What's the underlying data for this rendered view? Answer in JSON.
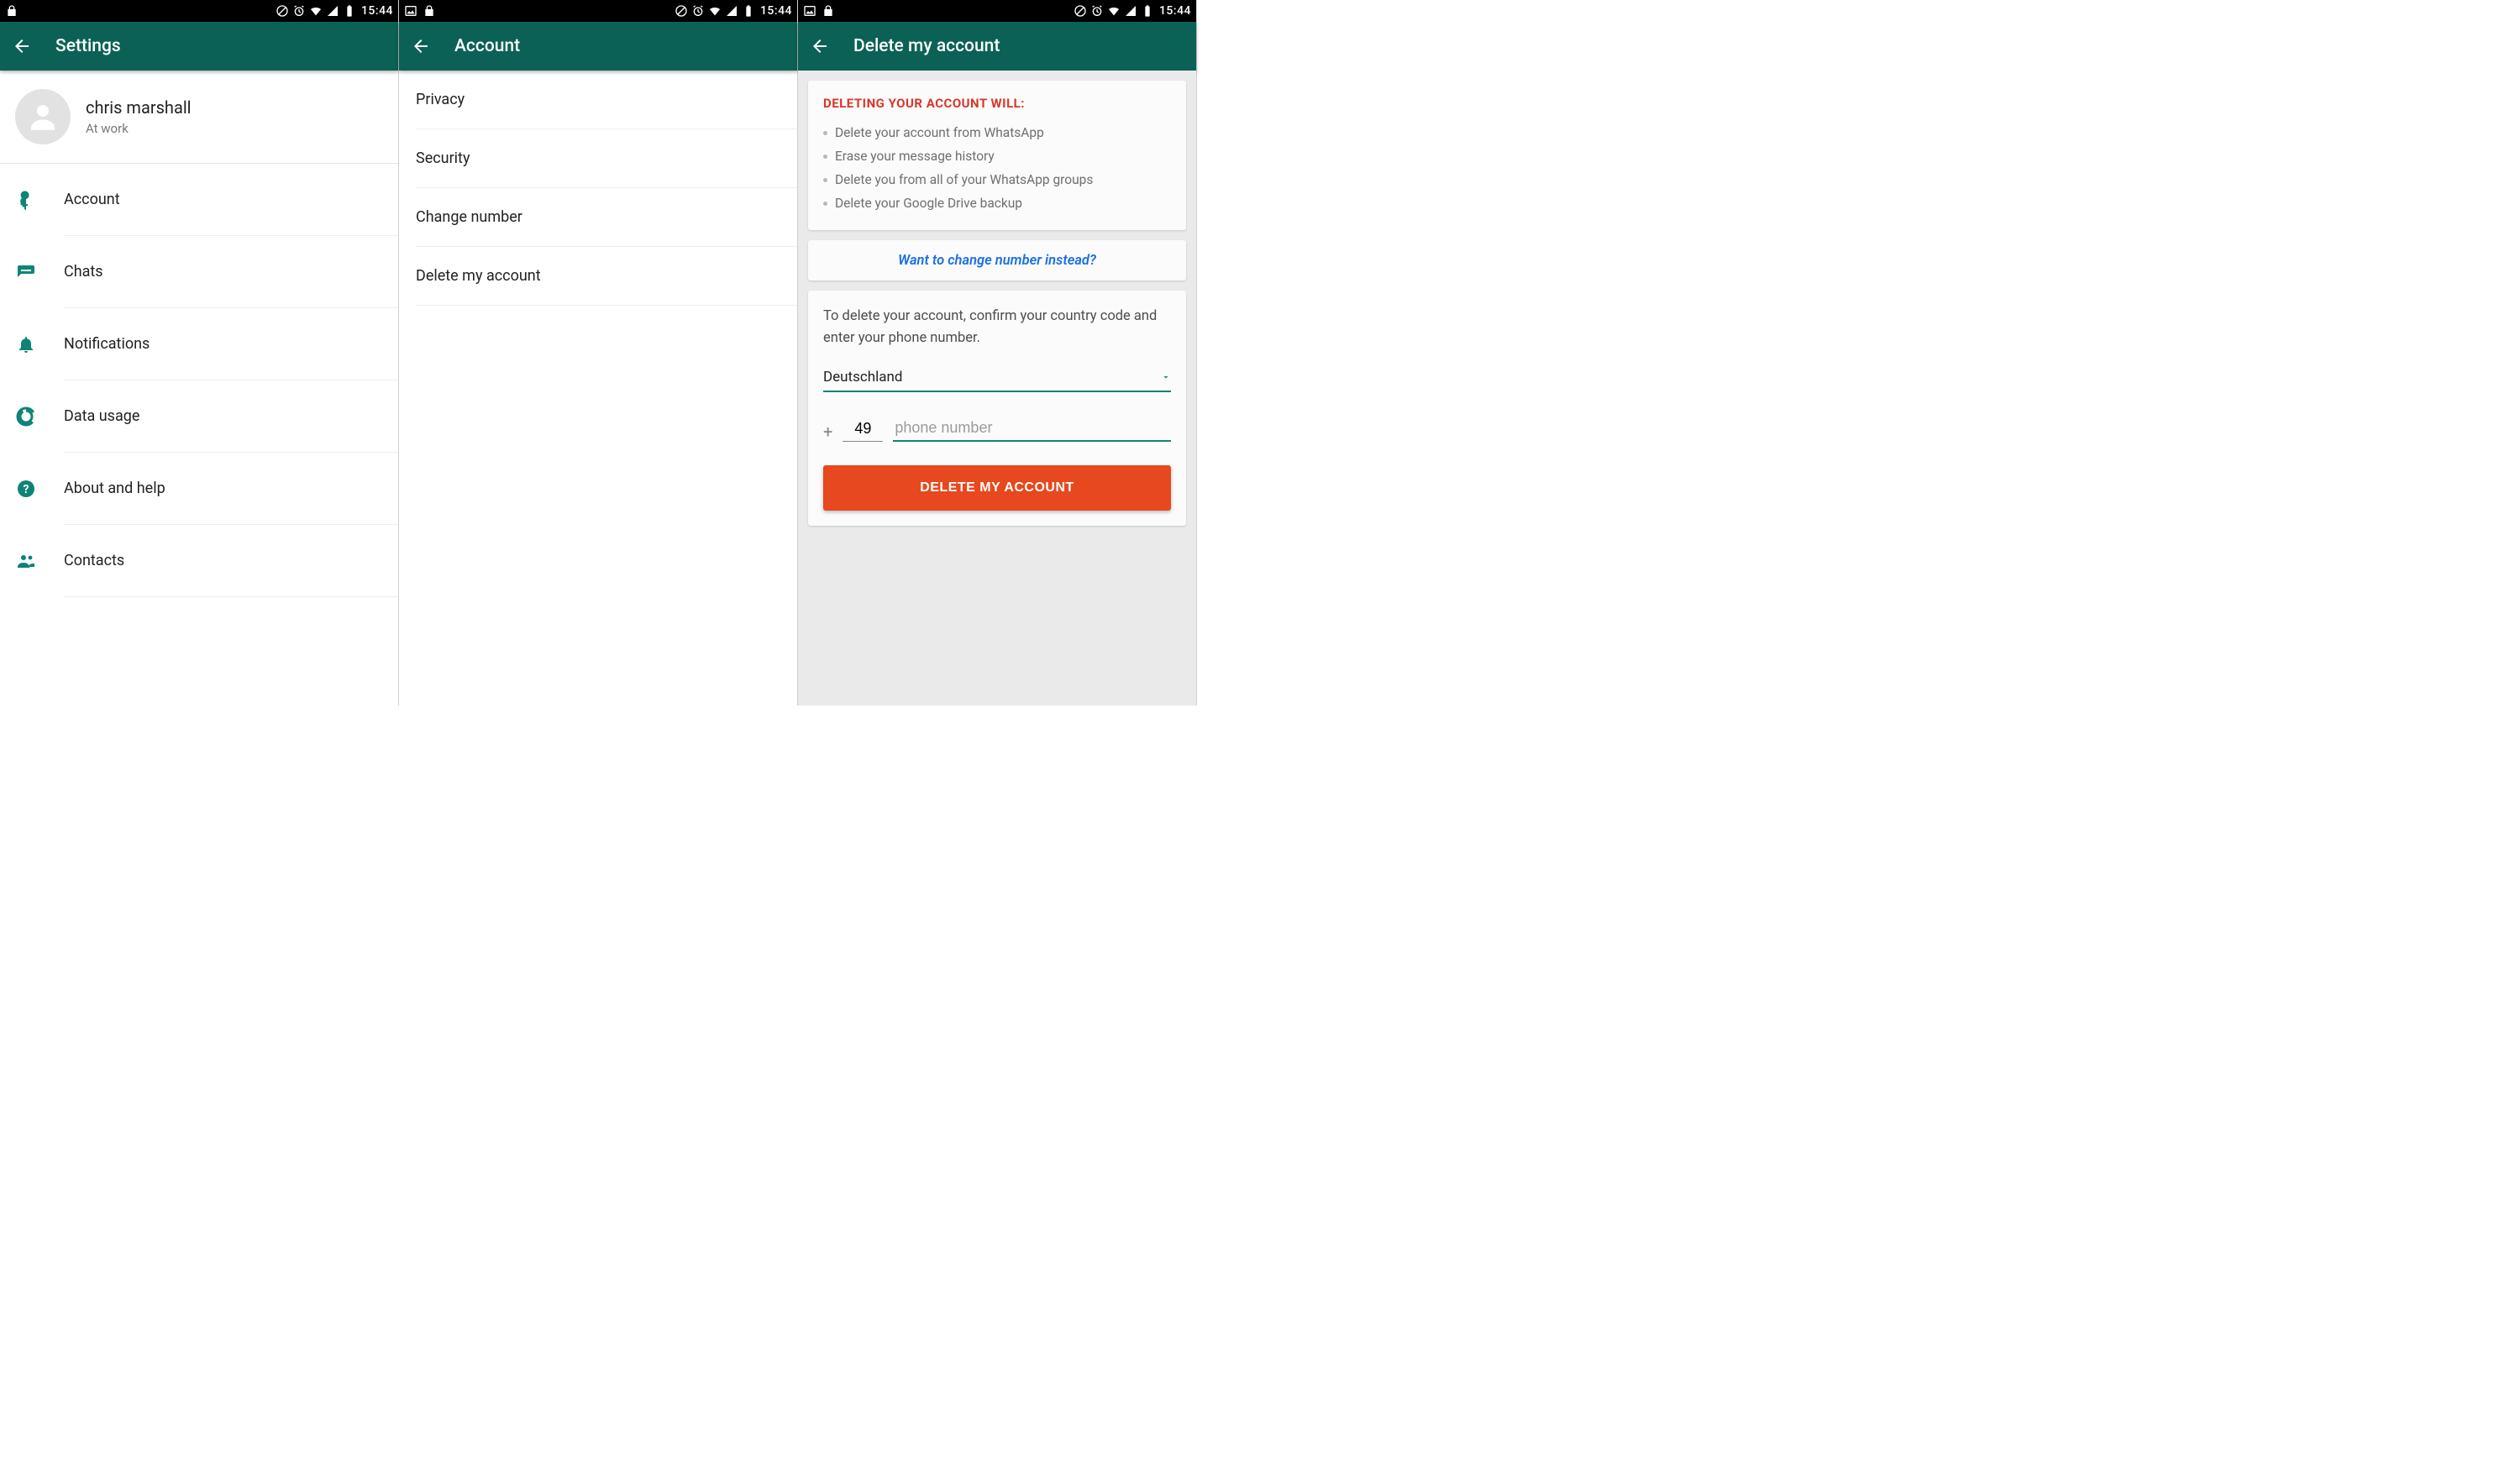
{
  "status": {
    "time": "15:44"
  },
  "screen1": {
    "title": "Settings",
    "profile": {
      "name": "chris marshall",
      "status_text": "At work"
    },
    "items": [
      {
        "label": "Account"
      },
      {
        "label": "Chats"
      },
      {
        "label": "Notifications"
      },
      {
        "label": "Data usage"
      },
      {
        "label": "About and help"
      },
      {
        "label": "Contacts"
      }
    ]
  },
  "screen2": {
    "title": "Account",
    "items": [
      {
        "label": "Privacy"
      },
      {
        "label": "Security"
      },
      {
        "label": "Change number"
      },
      {
        "label": "Delete my account"
      }
    ]
  },
  "screen3": {
    "title": "Delete my account",
    "warning_heading": "DELETING YOUR ACCOUNT WILL:",
    "warning_items": [
      "Delete your account from WhatsApp",
      "Erase your message history",
      "Delete you from all of your WhatsApp groups",
      "Delete your Google Drive backup"
    ],
    "change_number_prompt": "Want to change number instead?",
    "confirm_text": "To delete your account, confirm your country code and enter your phone number.",
    "country": "Deutschland",
    "country_code": "49",
    "phone_placeholder": "phone number",
    "delete_button": "DELETE MY ACCOUNT"
  }
}
